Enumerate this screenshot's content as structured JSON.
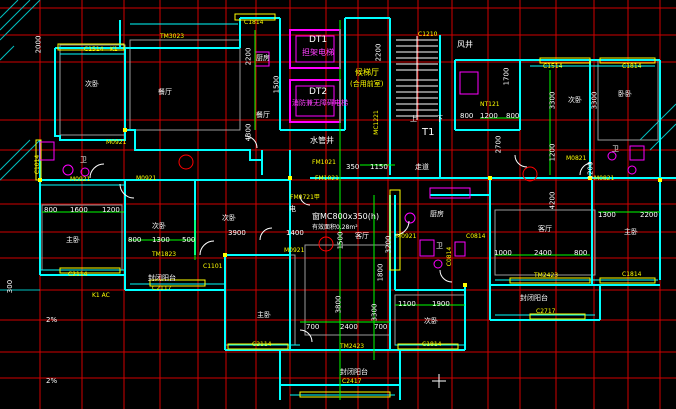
{
  "colors": {
    "background": "#000000",
    "wall": "#00ffff",
    "axis": "#ff0000",
    "window": "#ffff00",
    "elevator": "#ff00ff",
    "dimension": "#00ff00",
    "text": "#ffffff"
  },
  "elevators": {
    "dt1": {
      "code": "DT1",
      "name": "担架电梯"
    },
    "dt2": {
      "code": "DT2",
      "name": "消防兼无障碍电梯"
    },
    "hall": {
      "name": "候梯厅",
      "note": "(合用前室)"
    }
  },
  "stair": {
    "code": "T1",
    "up": "上",
    "down": "下"
  },
  "rooms": {
    "dining_l": "餐厅",
    "dining_l2": "餐厅",
    "bed_tl": "次卧",
    "kitchen_t": "厨房",
    "wc_l": "卫",
    "master_l": "主卧",
    "bed2_l": "次卧",
    "bed3_l": "次卧",
    "balcony_l": "封闭阳台",
    "master_c": "主卧",
    "hall_c": "客厅",
    "bed_c": "次卧",
    "kitchen_c": "厨房",
    "corridor": "走道",
    "shaft_water": "水管井",
    "shaft_air": "风井",
    "shaft_elec": "电",
    "living_r": "客厅",
    "bed_r1": "次卧",
    "bed_r2": "卧卧",
    "bed_r3": "主卧",
    "balcony_r": "封闭阳台",
    "balcony_c": "封闭阳台",
    "wc_c": "卫",
    "wc_r": "卫",
    "vent_note": "窗MC800x350(h)",
    "vent_note2": "有效面积0.28m²"
  },
  "codes": {
    "c1814_t": "C1814",
    "c1514_t": "C1514",
    "k1_t": "K1",
    "tm3023": "TM3023",
    "c1210": "C1210",
    "fm1021": "FM1021",
    "fm1021b": "FM1021",
    "fm0721": "FM0721甲",
    "m0921_a": "M0921",
    "m0921_b": "M0921",
    "m0921_c": "M0921",
    "m0921_d": "M0921",
    "m0921_e": "M0921",
    "m0821": "M0821",
    "c2114_a": "C2114",
    "c2114_b": "C2114",
    "c2117": "C2117",
    "c1014": "C1014",
    "tm1823": "TM1823",
    "c1101": "C1101",
    "tm2423": "TM2423",
    "c2417": "C2417",
    "c1814_b": "C1814",
    "c1814_r": "C1814",
    "tm2423_r": "TM2423",
    "c2717": "C2717",
    "c0814": "C0814",
    "c0814b": "C0814",
    "mc1221": "MC1221",
    "k1ac": "K1 AC",
    "c1514_r": "C1514",
    "c1814_rr": "C1814",
    "c1814_top": "C1814",
    "nt121": "NT121",
    "m0821b": "M0821"
  },
  "dims": {
    "d2200": "2200",
    "d1500": "1500",
    "d2200b": "2200",
    "d4300": "4300",
    "d3300": "3300",
    "d2700": "2700",
    "d800a": "800",
    "d1600": "1600",
    "d1200a": "1200",
    "d800b": "800",
    "d1300": "1300",
    "d3900": "3900",
    "d500": "500",
    "d1400": "1400",
    "d350": "350",
    "d1150": "1150",
    "d1500b": "1500",
    "d3800": "3800",
    "d3300b": "3300",
    "d1100": "1100",
    "d1900": "1900",
    "d700a": "700",
    "d2400": "2400",
    "d700b": "700",
    "d1000": "1000",
    "d2400b": "2400",
    "d800c": "800",
    "d1300b": "1300",
    "d2200c": "2200",
    "d800d": "800",
    "d1200b": "1200",
    "d800e": "800",
    "d3300r": "3300",
    "d1200r": "1200",
    "d1700": "1700",
    "d4200": "4200",
    "d1200c": "1200",
    "d2000": "2000",
    "d300": "300",
    "d3200": "3200",
    "d1800": "1800",
    "d2fuse": "2%",
    "d2fuse2": "2%"
  }
}
